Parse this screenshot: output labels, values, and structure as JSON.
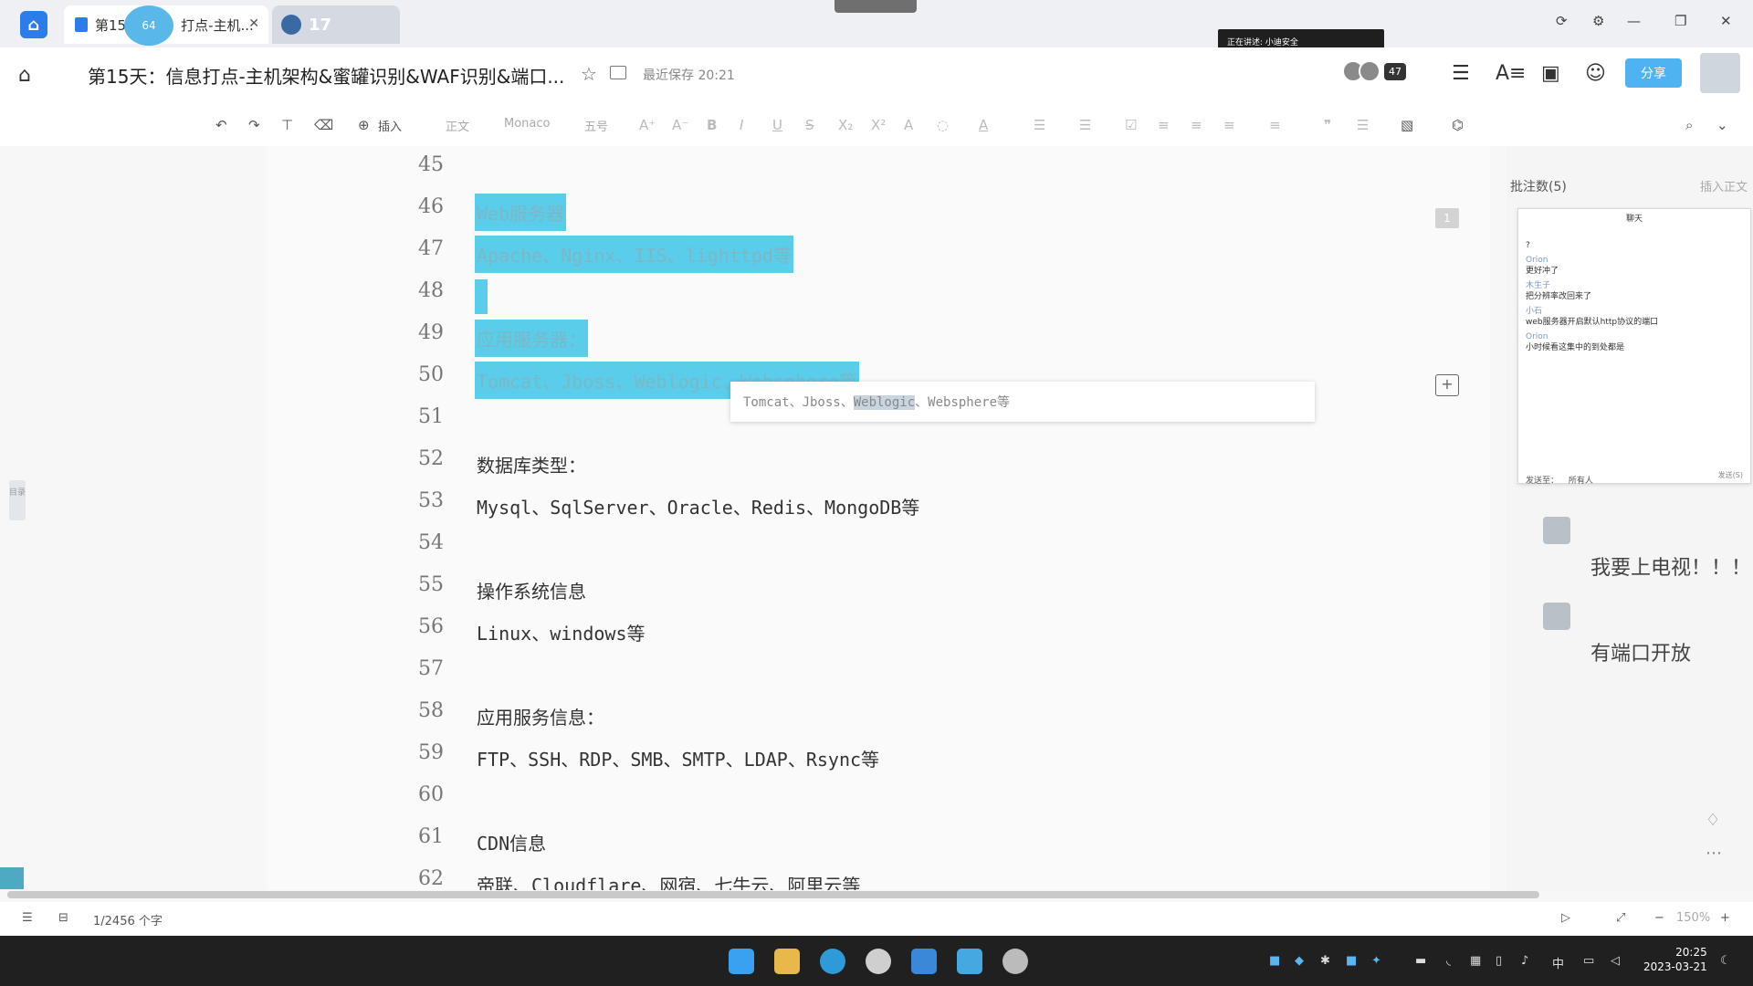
{
  "tabs": [
    {
      "label": "第15",
      "label2": "打点-主机...",
      "counter": "64"
    },
    {
      "label": "17"
    }
  ],
  "meeting_banner": "正在讲述: 小迪安全",
  "document": {
    "title": "第15天：信息打点-主机架构&蜜罐识别&WAF识别&端口...",
    "save_status": "最近保存 20:21",
    "collaborator_count": "47",
    "share_label": "分享"
  },
  "toolbar": {
    "insert_label": "插入",
    "style_label": "正文",
    "font_label": "Monaco",
    "size_label": "五号"
  },
  "lines": [
    {
      "num": "45",
      "text": ""
    },
    {
      "num": "46",
      "text": "Web服务器"
    },
    {
      "num": "47",
      "text": "Apache、Nginx、IIS、lighttpd等"
    },
    {
      "num": "48",
      "text": ""
    },
    {
      "num": "49",
      "text": "应用服务器："
    },
    {
      "num": "50",
      "text": "Tomcat、Jboss、Weblogic、Websphere等"
    },
    {
      "num": "51",
      "text": ""
    },
    {
      "num": "52",
      "text": "数据库类型："
    },
    {
      "num": "53",
      "text": "Mysql、SqlServer、Oracle、Redis、MongoDB等"
    },
    {
      "num": "54",
      "text": ""
    },
    {
      "num": "55",
      "text": "操作系统信息"
    },
    {
      "num": "56",
      "text": "Linux、windows等"
    },
    {
      "num": "57",
      "text": ""
    },
    {
      "num": "58",
      "text": "应用服务信息："
    },
    {
      "num": "59",
      "text": "FTP、SSH、RDP、SMB、SMTP、LDAP、Rsync等"
    },
    {
      "num": "60",
      "text": ""
    },
    {
      "num": "61",
      "text": "CDN信息"
    },
    {
      "num": "62",
      "text": "帝联、Cloudflare、网宿、七牛云、阿里云等"
    }
  ],
  "tooltip": {
    "before": "Tomcat、Jboss、",
    "highlight": "Weblogic",
    "after": "、Websphere等"
  },
  "margin_badge": "1",
  "right_panel": {
    "title": "批注数(5)",
    "insert_link": "插入正文",
    "chat_header": "聊天",
    "chat_messages": [
      {
        "who": "",
        "text": "?"
      },
      {
        "who": "Orion",
        "text": "更好冲了"
      },
      {
        "who": "木生子",
        "text": "把分辨率改回来了"
      },
      {
        "who": "小石",
        "text": "web服务器开启默认http协议的端口"
      },
      {
        "who": "Orion",
        "text": "小时候看这集中的到处都是"
      }
    ],
    "chat_footer_label": "发送至：",
    "chat_footer_value": "所有人",
    "chat_footer_send": "发送(S)",
    "comments": [
      {
        "text": "我要上电视！！！"
      },
      {
        "text": "有端口开放"
      }
    ]
  },
  "statusbar": {
    "word_count": "1/2456 个字",
    "zoom": "150%"
  },
  "clock": {
    "time": "20:25",
    "date": "2023-03-21"
  },
  "tray": {
    "ime": "中"
  }
}
